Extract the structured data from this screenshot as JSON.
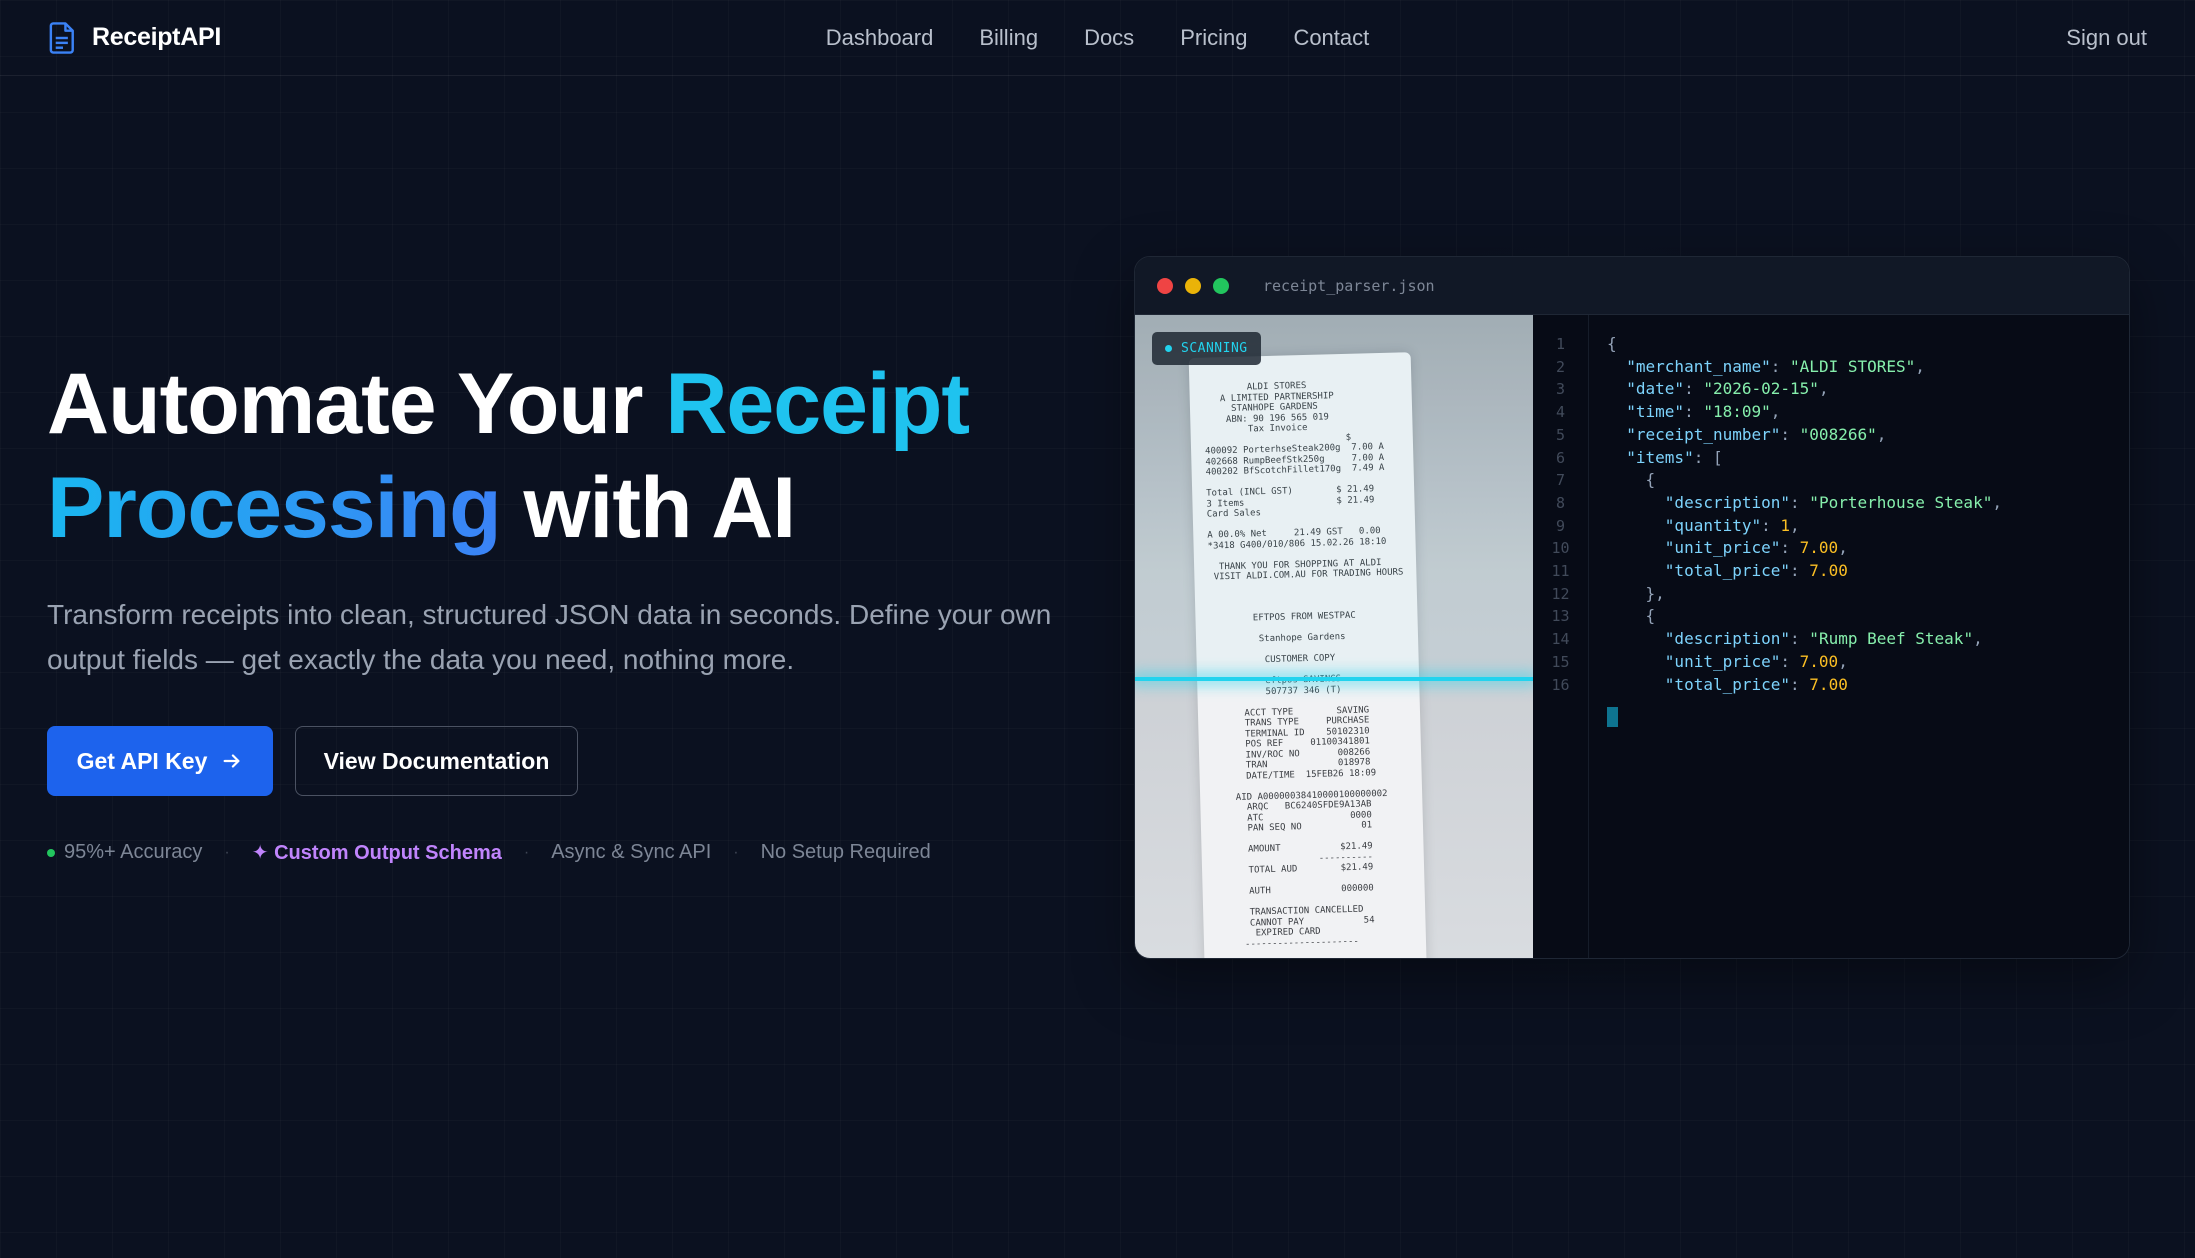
{
  "brand": {
    "name": "ReceiptAPI"
  },
  "nav": {
    "links": [
      "Dashboard",
      "Billing",
      "Docs",
      "Pricing",
      "Contact"
    ],
    "signout": "Sign out"
  },
  "hero": {
    "title_part1": "Automate Your ",
    "title_highlight1": "Receipt",
    "title_highlight2": "Processing",
    "title_part2": " with AI",
    "subtitle": "Transform receipts into clean, structured JSON data in seconds. Define your own output fields — get exactly the data you need, nothing more.",
    "primary_button": "Get API Key",
    "secondary_button": "View Documentation"
  },
  "features": [
    "95%+ Accuracy",
    "✦ Custom Output Schema",
    "Async & Sync API",
    "No Setup Required"
  ],
  "window": {
    "filename": "receipt_parser.json",
    "scan_badge": "SCANNING",
    "line_numbers": [
      "1",
      "2",
      "3",
      "4",
      "5",
      "6",
      "7",
      "8",
      "9",
      "10",
      "11",
      "12",
      "13",
      "14",
      "15",
      "16"
    ],
    "json": {
      "merchant_name": "ALDI STORES",
      "date": "2026-02-15",
      "time": "18:09",
      "receipt_number": "008266",
      "item1_description": "Porterhouse Steak",
      "item1_quantity": "1",
      "item1_unit_price": "7.00",
      "item1_total_price": "7.00",
      "item2_description": "Rump Beef Steak",
      "item2_unit_price": "7.00",
      "item2_total_price": "7.00"
    },
    "receipt_text": "        ALDI STORES\n   A LIMITED PARTNERSHIP\n     STANHOPE GARDENS\n    ABN: 90 196 565 019\n        Tax Invoice\n                          $\n400092 PorterhseSteak200g  7.00 A\n402668 RumpBeefStk250g     7.00 A\n400202 BfScotchFillet170g  7.49 A\n\nTotal (INCL GST)        $ 21.49\n3 Items                 $ 21.49\nCard Sales\n\nA 00.0% Net     21.49 GST   0.00\n*3418 G400/010/806 15.02.26 18:10\n\n  THANK YOU FOR SHOPPING AT ALDI\n VISIT ALDI.COM.AU FOR TRADING HOURS\n\n\n\n        EFTPOS FROM WESTPAC\n\n         Stanhope Gardens\n\n          CUSTOMER COPY\n\n          eftpos SAVINGS\n          507737 346 (T)\n\n      ACCT TYPE        SAVING\n      TRANS TYPE     PURCHASE\n      TERMINAL ID    50102310\n      POS REF     01100341801\n      INV/ROC NO       008266\n      TRAN             018978\n      DATE/TIME  15FEB26 18:09\n\n    AID A00000038410000100000002\n      ARQC   BC6240SFDE9A13AB\n      ATC                0000\n      PAN SEQ NO           01\n\n      AMOUNT           $21.49\n                   ----------\n      TOTAL AUD        $21.49\n\n      AUTH             000000\n\n      TRANSACTION CANCELLED\n      CANNOT PAY           54\n       EXPIRED CARD\n     ---------------------"
  },
  "colors": {
    "background": "#0b1120",
    "accent_cyan": "#1fc3ef",
    "primary_button": "#1d63ed",
    "json_key": "#7dd3fc",
    "json_string": "#86efac",
    "json_number": "#fbbf24",
    "traffic_red": "#ef4444",
    "traffic_yellow": "#eab308",
    "traffic_green": "#22c55e"
  }
}
